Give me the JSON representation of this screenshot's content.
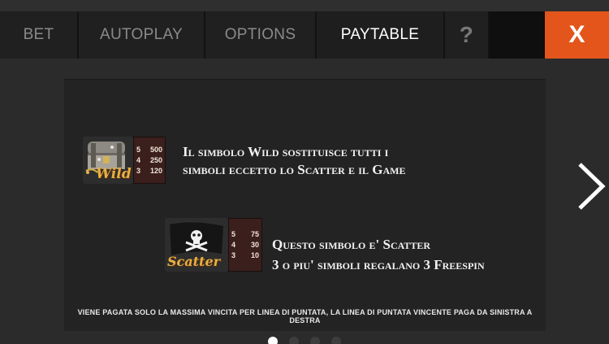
{
  "tabs": [
    {
      "label": "BET"
    },
    {
      "label": "AUTOPLAY"
    },
    {
      "label": "OPTIONS"
    },
    {
      "label": "PAYTABLE",
      "active": true
    },
    {
      "label": "?"
    }
  ],
  "close_label": "X",
  "symbols": {
    "wild": {
      "image_caption": "Wild",
      "icon": "treasure-chest-icon",
      "payouts": [
        {
          "count": "5",
          "value": "500"
        },
        {
          "count": "4",
          "value": "250"
        },
        {
          "count": "3",
          "value": "120"
        }
      ],
      "description_line1": "Il simbolo Wild sostituisce tutti i",
      "description_line2": "simboli eccetto lo Scatter e il Game"
    },
    "scatter": {
      "image_caption": "Scatter",
      "icon": "pirate-flag-icon",
      "payouts": [
        {
          "count": "5",
          "value": "75"
        },
        {
          "count": "4",
          "value": "30"
        },
        {
          "count": "3",
          "value": "10"
        }
      ],
      "description_line1": "Questo simbolo e' Scatter",
      "description_line2": "3 o piu' simboli regalano 3 Freespin"
    }
  },
  "footer_note": "VIENE PAGATA SOLO LA MASSIMA VINCITA PER LINEA DI PUNTATA, LA LINEA DI PUNTATA VINCENTE PAGA DA SINISTRA A DESTRA",
  "pagination": {
    "total": 4,
    "current": 1
  },
  "colors": {
    "close_bg": "#e3551b",
    "panel_bg": "#232323",
    "tab_bar_bg": "#1a1a1a",
    "paytable_bg": "#3a1f1c"
  }
}
